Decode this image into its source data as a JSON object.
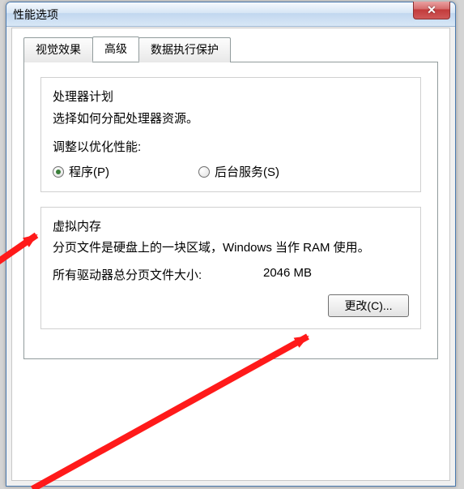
{
  "window": {
    "title": "性能选项",
    "close_icon": "✕"
  },
  "tabs": [
    {
      "label": "视觉效果",
      "active": false
    },
    {
      "label": "高级",
      "active": true
    },
    {
      "label": "数据执行保护",
      "active": false
    }
  ],
  "processor": {
    "title": "处理器计划",
    "desc": "选择如何分配处理器资源。",
    "optimize_label": "调整以优化性能:",
    "radio_programs": "程序(P)",
    "radio_services": "后台服务(S)"
  },
  "virtual_memory": {
    "title": "虚拟内存",
    "desc": "分页文件是硬盘上的一块区域，Windows 当作 RAM 使用。",
    "size_label": "所有驱动器总分页文件大小:",
    "size_value": "2046 MB",
    "change_btn": "更改(C)..."
  }
}
